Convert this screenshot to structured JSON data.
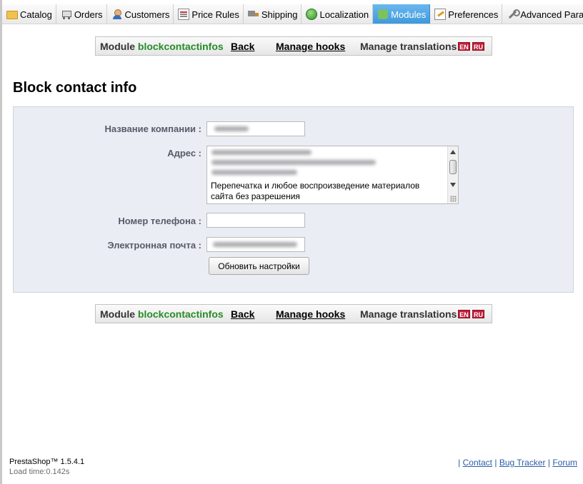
{
  "topmenu": {
    "tabs": [
      {
        "label": "Catalog",
        "icon": "folder-icon"
      },
      {
        "label": "Orders",
        "icon": "cart-icon"
      },
      {
        "label": "Customers",
        "icon": "user-icon"
      },
      {
        "label": "Price Rules",
        "icon": "price-icon"
      },
      {
        "label": "Shipping",
        "icon": "truck-icon"
      },
      {
        "label": "Localization",
        "icon": "globe-icon"
      },
      {
        "label": "Modules",
        "icon": "puzzle-icon",
        "active": true
      },
      {
        "label": "Preferences",
        "icon": "preferences-icon"
      },
      {
        "label": "Advanced Parameters",
        "icon": "wrench-icon"
      }
    ],
    "active_color": "#4aa6e6"
  },
  "module_bar": {
    "module_label": "Module",
    "module_name": "blockcontactinfos",
    "back": "Back",
    "manage_hooks": "Manage hooks",
    "manage_translations": "Manage translations",
    "flags": [
      "EN",
      "RU"
    ],
    "module_name_color": "#268c26"
  },
  "page": {
    "title": "Block contact info"
  },
  "form": {
    "company_label": "Название компании :",
    "address_label": "Адрес :",
    "address_visible_text": "Перепечатка и любое воспроизведение материалов сайта без разрешения",
    "phone_label": "Номер телефона :",
    "phone_value": "",
    "email_label": "Электронная почта :",
    "submit_label": "Обновить настройки",
    "panel_color": "#ebedf4"
  },
  "footer": {
    "version": "PrestaShop™ 1.5.4.1",
    "load_time": "Load time:0.142s",
    "links": [
      "Contact",
      "Bug Tracker",
      "Forum"
    ]
  }
}
